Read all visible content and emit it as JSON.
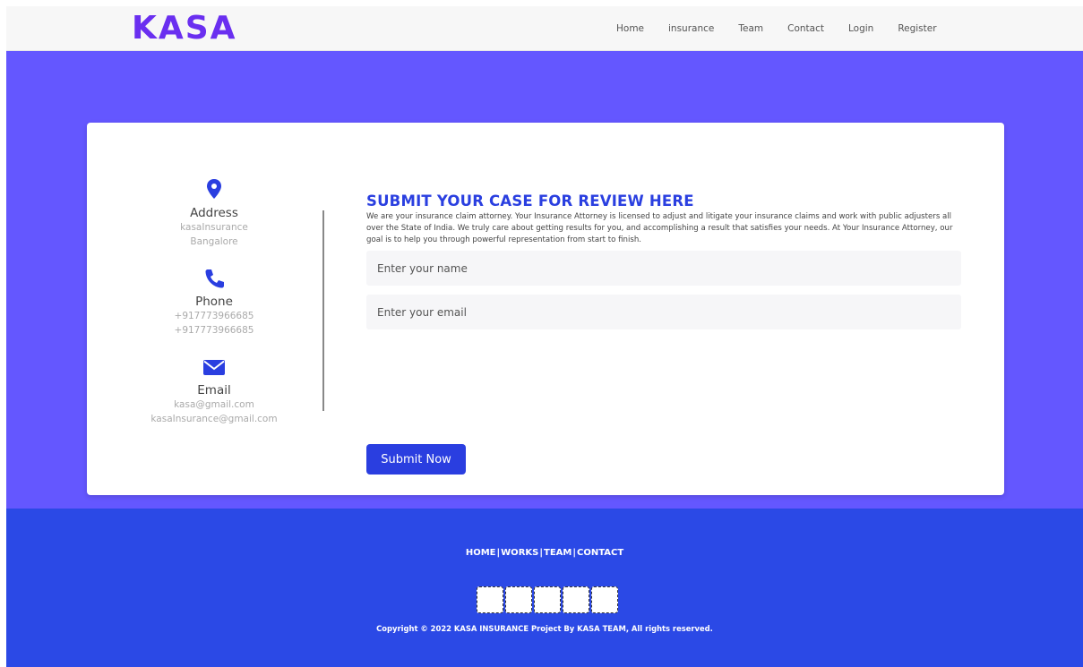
{
  "header": {
    "logo": "KASA",
    "nav": [
      "Home",
      "insurance",
      "Team",
      "Contact",
      "Login",
      "Register"
    ]
  },
  "contact_info": {
    "address": {
      "title": "Address",
      "lines": [
        "kasaInsurance",
        "Bangalore"
      ],
      "icon": "map-pin-icon"
    },
    "phone": {
      "title": "Phone",
      "lines": [
        "+917773966685",
        "+917773966685"
      ],
      "icon": "phone-icon"
    },
    "email": {
      "title": "Email",
      "lines": [
        "kasa@gmail.com",
        "kasaInsurance@gmail.com"
      ],
      "icon": "envelope-icon"
    }
  },
  "form": {
    "title": "SUBMIT YOUR CASE FOR REVIEW HERE",
    "description": "We are your insurance claim attorney. Your Insurance Attorney is licensed to adjust and litigate your insurance claims and work with public adjusters all over the State of India. We truly care about getting results for you, and accomplishing a result that satisfies your needs. At Your Insurance Attorney, our goal is to help you through powerful representation from start to finish.",
    "name_placeholder": "Enter your name",
    "email_placeholder": "Enter your email",
    "submit_label": "Submit Now"
  },
  "footer": {
    "links": [
      "HOME",
      "WORKS",
      "TEAM",
      "CONTACT"
    ],
    "copyright": "Copyright © 2022 KASA INSURANCE Project By KASA TEAM, All rights reserved."
  },
  "colors": {
    "brand_purple": "#6a2ff0",
    "hero_bg": "#6457ff",
    "accent_blue": "#2a3ee0",
    "footer_bg": "#2b49e6"
  }
}
